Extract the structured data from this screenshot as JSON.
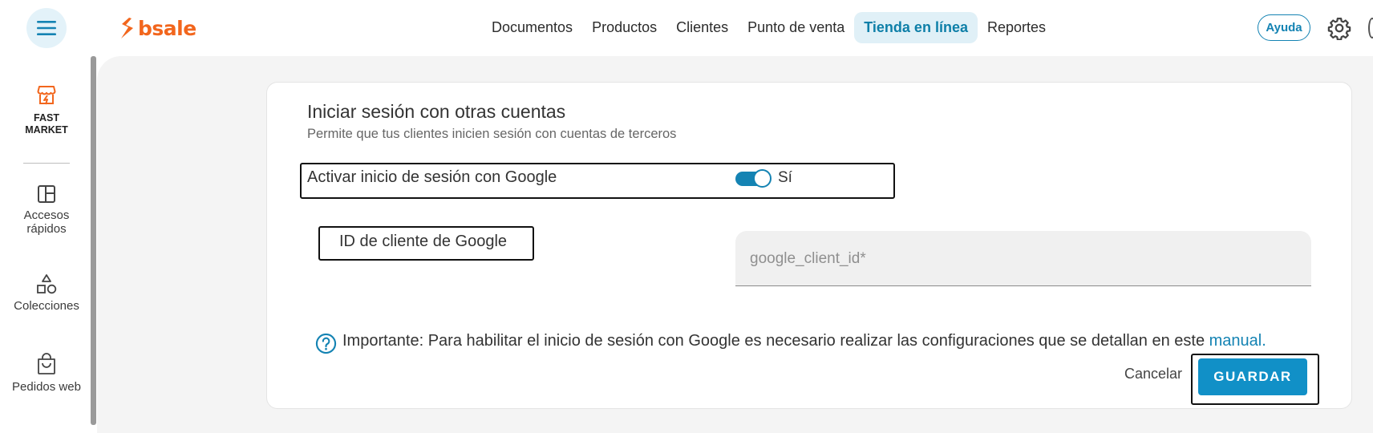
{
  "app": {
    "logo_text": "bsale",
    "brand_color": "#f2661d",
    "accent_color": "#1483b3"
  },
  "header": {
    "menu_icon": "hamburger-icon",
    "nav": [
      {
        "label": "Documentos",
        "active": false
      },
      {
        "label": "Productos",
        "active": false
      },
      {
        "label": "Clientes",
        "active": false
      },
      {
        "label": "Punto de venta",
        "active": false
      },
      {
        "label": "Tienda en línea",
        "active": true
      },
      {
        "label": "Reportes",
        "active": false
      }
    ],
    "help_label": "Ayuda",
    "settings_icon": "gear-icon"
  },
  "sidebar": {
    "store_line1": "FAST",
    "store_line2": "MARKET",
    "items": [
      {
        "line1": "Accesos",
        "line2": "rápidos",
        "icon": "layout-icon"
      },
      {
        "line1": "Colecciones",
        "line2": "",
        "icon": "shapes-icon"
      },
      {
        "line1": "Pedidos web",
        "line2": "",
        "icon": "shopping-bag-icon"
      }
    ]
  },
  "section": {
    "title": "Iniciar sesión con otras cuentas",
    "subtitle": "Permite que tus clientes inicien sesión con cuentas de terceros",
    "google_toggle_label": "Activar inicio de sesión con Google",
    "google_toggle_state": "Sí",
    "google_toggle_on": true,
    "client_id_label": "ID de cliente de Google",
    "client_id_value": "",
    "client_id_placeholder": "google_client_id*",
    "info_text": "Importante: Para habilitar el inicio de sesión con Google es necesario realizar las configuraciones que se detallan en este ",
    "info_link": "manual."
  },
  "actions": {
    "cancel_label": "Cancelar",
    "save_label": "GUARDAR"
  }
}
